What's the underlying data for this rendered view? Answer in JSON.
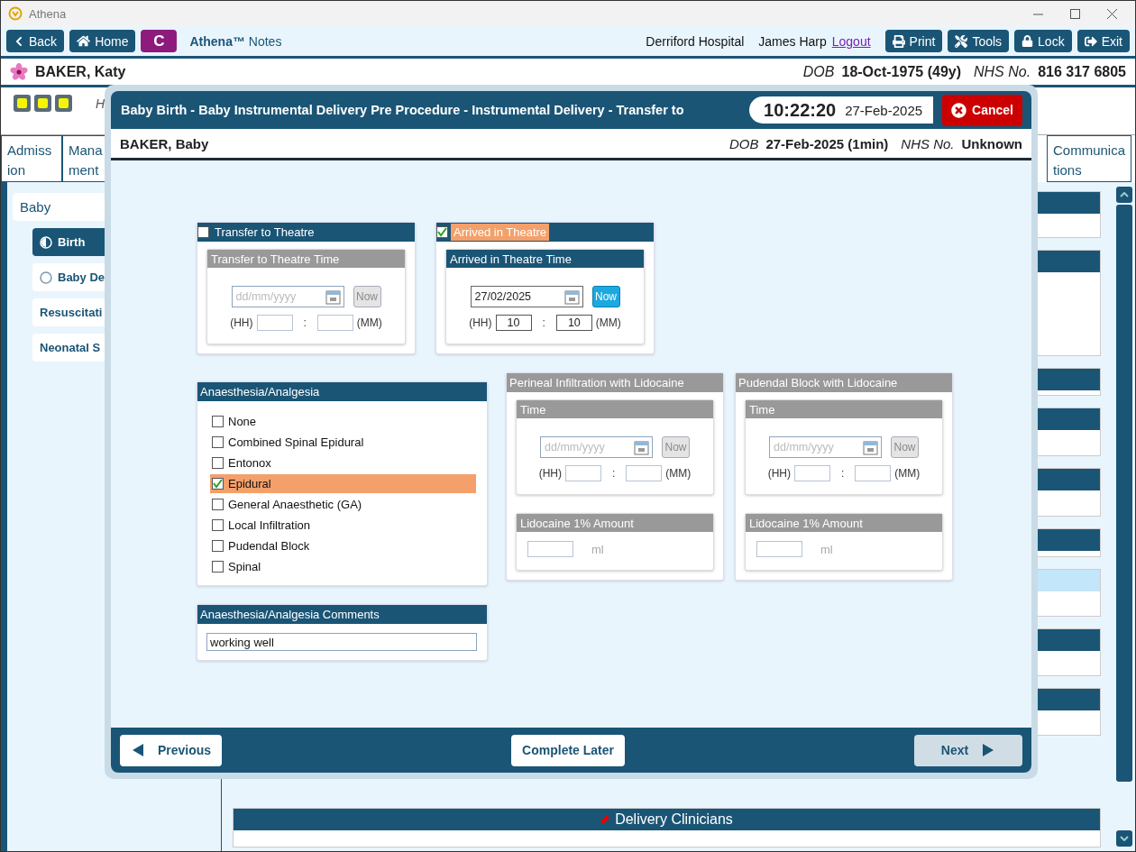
{
  "window": {
    "title": "Athena"
  },
  "toolbar": {
    "nav": [
      {
        "label": "Back",
        "kind": "back"
      },
      {
        "label": "Home",
        "kind": "home"
      }
    ],
    "badge": "C",
    "app_name": "Athena™",
    "app_suffix": "Notes",
    "hospital": "Derriford Hospital",
    "user": "James Harp",
    "logout": "Logout",
    "actions": [
      {
        "label": "Print",
        "kind": "print"
      },
      {
        "label": "Tools",
        "kind": "tools"
      },
      {
        "label": "Lock",
        "kind": "lock"
      },
      {
        "label": "Exit",
        "kind": "exit"
      }
    ]
  },
  "patient": {
    "name": "BAKER, Katy",
    "dob_label": "DOB",
    "dob": "18-Oct-1975 (49y)",
    "nhs_label": "NHS No.",
    "nhs": "816 317 6805"
  },
  "info_row": {
    "text": "H"
  },
  "tabs": [
    {
      "lines": [
        "Admiss",
        "ion"
      ]
    },
    {
      "lines": [
        "Mana",
        "ment"
      ]
    },
    {
      "lines": [
        "Communica",
        "tions"
      ]
    }
  ],
  "sidebar": {
    "section": "Baby",
    "items": [
      {
        "label": "Birth",
        "selected": true,
        "kind": "partial"
      },
      {
        "label": "Baby De",
        "selected": false,
        "kind": "empty"
      },
      {
        "label": "Resuscitati",
        "selected": false,
        "kind": "plain"
      },
      {
        "label": "Neonatal S",
        "selected": false,
        "kind": "plain"
      }
    ]
  },
  "sections": {
    "bottom_title": "Delivery Clinicians"
  },
  "dialog": {
    "title": "Baby Birth - Baby Instrumental Delivery Pre Procedure - Instrumental Delivery - Transfer to",
    "time": "10:22:20",
    "date": "27-Feb-2025",
    "cancel": "Cancel",
    "patient": {
      "name": "BAKER, Baby",
      "dob_label": "DOB",
      "dob": "27-Feb-2025 (1min)",
      "nhs_label": "NHS No.",
      "nhs": "Unknown"
    },
    "events": [
      {
        "label": "Transfer to Theatre",
        "checked": false,
        "time_title": "Transfer to Theatre Time",
        "date_placeholder": "dd/mm/yyyy",
        "now": "Now",
        "hh_label": "(HH)",
        "sep": ":",
        "mm_label": "(MM)"
      },
      {
        "label": "Arrived in Theatre",
        "checked": true,
        "time_title": "Arrived in Theatre Time",
        "date": "27/02/2025",
        "now": "Now",
        "hh_label": "(HH)",
        "hh": "10",
        "sep": ":",
        "mm_label": "(MM)",
        "mm": "10"
      }
    ],
    "anaesthesia": {
      "title": "Anaesthesia/Analgesia",
      "options": [
        {
          "label": "None",
          "checked": false
        },
        {
          "label": "Combined Spinal Epidural",
          "checked": false
        },
        {
          "label": "Entonox",
          "checked": false
        },
        {
          "label": "Epidural",
          "checked": true
        },
        {
          "label": "General Anaesthetic (GA)",
          "checked": false
        },
        {
          "label": "Local Infiltration",
          "checked": false
        },
        {
          "label": "Pudendal Block",
          "checked": false
        },
        {
          "label": "Spinal",
          "checked": false
        }
      ]
    },
    "lidocaine": [
      {
        "title": "Perineal Infiltration with Lidocaine",
        "disabled": true,
        "time_title": "Time",
        "date_placeholder": "dd/mm/yyyy",
        "now": "Now",
        "hh_label": "(HH)",
        "sep": ":",
        "mm_label": "(MM)",
        "amount_title": "Lidocaine 1% Amount",
        "unit": "ml"
      },
      {
        "title": "Pudendal Block with Lidocaine",
        "disabled": true,
        "time_title": "Time",
        "date_placeholder": "dd/mm/yyyy",
        "now": "Now",
        "hh_label": "(HH)",
        "sep": ":",
        "mm_label": "(MM)",
        "amount_title": "Lidocaine 1% Amount",
        "unit": "ml"
      }
    ],
    "comments": {
      "title": "Anaesthesia/Analgesia Comments",
      "value": "working well"
    },
    "footer": {
      "previous": "Previous",
      "complete_later": "Complete Later",
      "next": {
        "label": "Next",
        "disabled": true
      }
    }
  }
}
